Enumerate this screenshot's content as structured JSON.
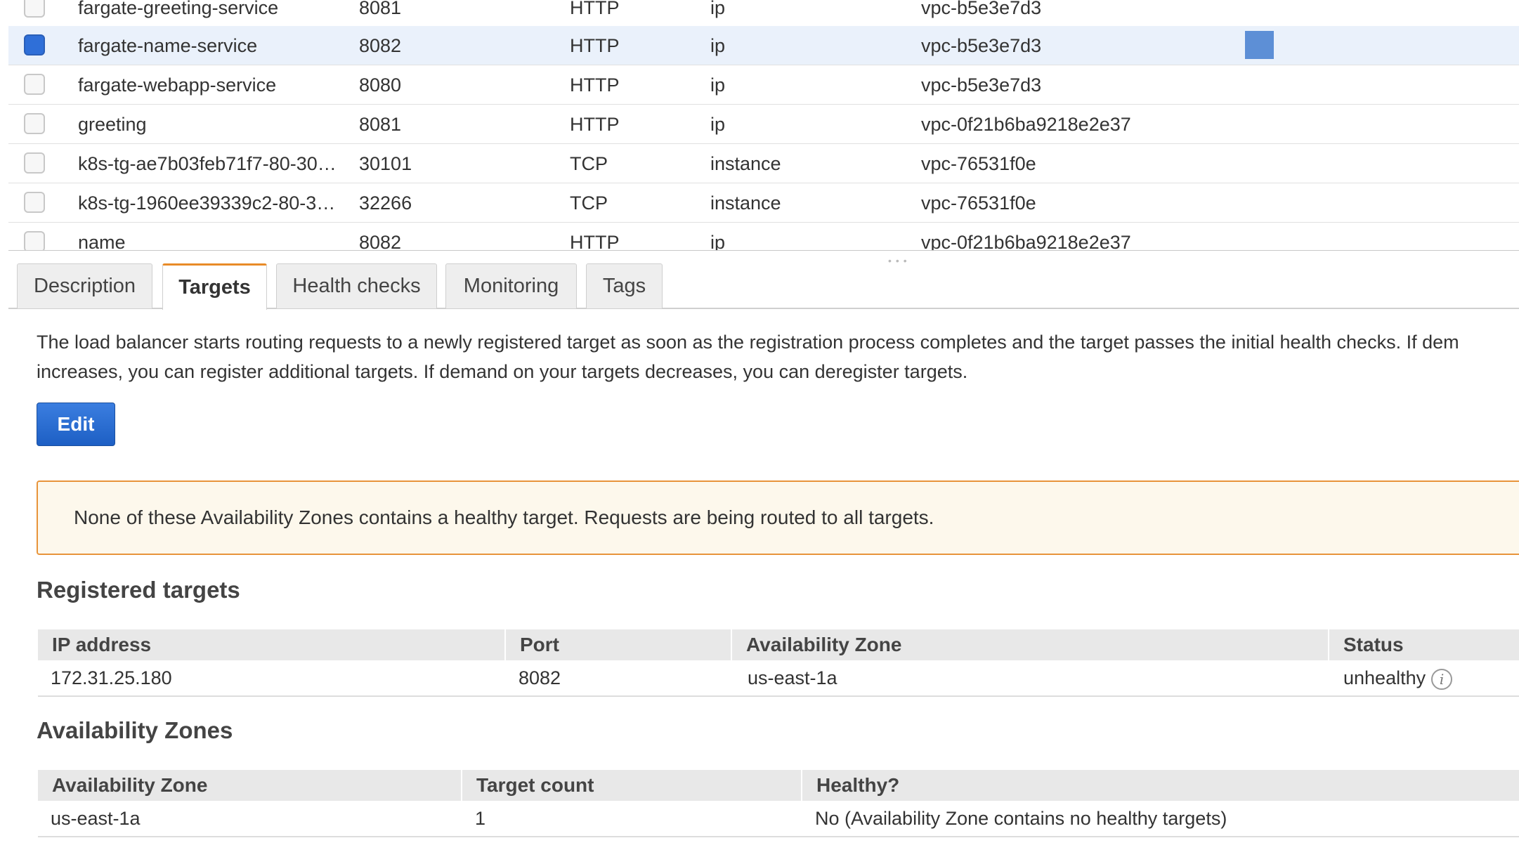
{
  "target_groups": {
    "rows": [
      {
        "name": "fargate-greeting-service",
        "port": "8081",
        "protocol": "HTTP",
        "target_type": "ip",
        "vpc": "vpc-b5e3e7d3",
        "selected": false
      },
      {
        "name": "fargate-name-service",
        "port": "8082",
        "protocol": "HTTP",
        "target_type": "ip",
        "vpc": "vpc-b5e3e7d3",
        "selected": true
      },
      {
        "name": "fargate-webapp-service",
        "port": "8080",
        "protocol": "HTTP",
        "target_type": "ip",
        "vpc": "vpc-b5e3e7d3",
        "selected": false
      },
      {
        "name": "greeting",
        "port": "8081",
        "protocol": "HTTP",
        "target_type": "ip",
        "vpc": "vpc-0f21b6ba9218e2e37",
        "selected": false
      },
      {
        "name": "k8s-tg-ae7b03feb71f7-80-30…",
        "port": "30101",
        "protocol": "TCP",
        "target_type": "instance",
        "vpc": "vpc-76531f0e",
        "selected": false
      },
      {
        "name": "k8s-tg-1960ee39339c2-80-3…",
        "port": "32266",
        "protocol": "TCP",
        "target_type": "instance",
        "vpc": "vpc-76531f0e",
        "selected": false
      },
      {
        "name": "name",
        "port": "8082",
        "protocol": "HTTP",
        "target_type": "ip",
        "vpc": "vpc-0f21b6ba9218e2e37",
        "selected": false
      }
    ]
  },
  "tabs": [
    {
      "label": "Description"
    },
    {
      "label": "Targets",
      "active": true
    },
    {
      "label": "Health checks"
    },
    {
      "label": "Monitoring"
    },
    {
      "label": "Tags"
    }
  ],
  "targets_panel": {
    "intro_line1": "The load balancer starts routing requests to a newly registered target as soon as the registration process completes and the target passes the initial health checks. If dem",
    "intro_line2": "increases, you can register additional targets. If demand on your targets decreases, you can deregister targets.",
    "edit_label": "Edit",
    "warning": "None of these Availability Zones contains a healthy target. Requests are being routed to all targets.",
    "registered_title": "Registered targets",
    "registered_headers": {
      "ip": "IP address",
      "port": "Port",
      "az": "Availability Zone",
      "status": "Status"
    },
    "registered_rows": [
      {
        "ip": "172.31.25.180",
        "port": "8082",
        "az": "us-east-1a",
        "status": "unhealthy"
      }
    ],
    "az_title": "Availability Zones",
    "az_headers": {
      "az": "Availability Zone",
      "count": "Target count",
      "healthy": "Healthy?"
    },
    "az_rows": [
      {
        "az": "us-east-1a",
        "count": "1",
        "healthy": "No (Availability Zone contains no healthy targets)"
      }
    ]
  },
  "colors": {
    "accent_tab": "#e88b28",
    "primary_button": "#1d5fc4",
    "warning_border": "#e8943a",
    "selected_row": "#eaf1fb"
  },
  "icons": {
    "status_info": "info-icon"
  }
}
